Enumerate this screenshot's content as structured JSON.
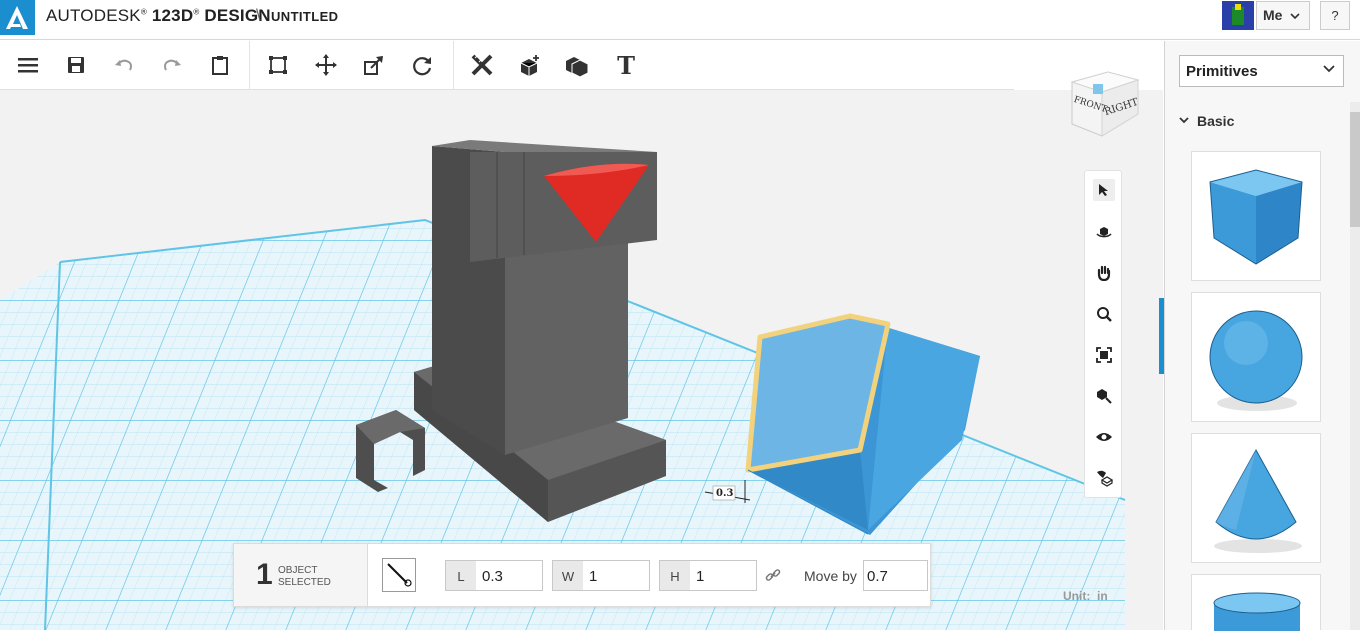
{
  "header": {
    "brand": "AUTODESK",
    "product": "123D",
    "product_suffix": "DESIGN",
    "separator": "\\",
    "document_title": "UNTITLED",
    "user_label": "Me",
    "help_label": "?"
  },
  "toolbar": {
    "text_tool_label": "T",
    "icons": [
      "menu-icon",
      "save-icon",
      "undo-icon",
      "redo-icon",
      "clipboard-icon",
      "smart-scale-icon",
      "move-icon",
      "scale-icon",
      "rotate-icon",
      "measure-icon",
      "primitives-icon",
      "combine-icon",
      "text-icon"
    ]
  },
  "viewcube": {
    "front": "FRONT",
    "right": "RIGHT"
  },
  "selection": {
    "count": "1",
    "label_line1": "OBJECT",
    "label_line2": "SELECTED",
    "dimension_tag": "0.3",
    "fields": [
      {
        "label": "L",
        "value": "0.3"
      },
      {
        "label": "W",
        "value": "1"
      },
      {
        "label": "H",
        "value": "1"
      }
    ],
    "move_by_label": "Move by",
    "move_by_value": "0.7"
  },
  "unit": {
    "label": "Unit:",
    "value": "in"
  },
  "panel": {
    "dropdown_value": "Primitives",
    "section_title": "Basic",
    "items": [
      "box-primitive",
      "sphere-primitive",
      "cone-primitive",
      "cylinder-primitive"
    ]
  },
  "colors": {
    "accent": "#1a8ecf",
    "selection_outline": "#f2d27c",
    "object_gray": "#5c5c5c",
    "cone_red": "#e02a24",
    "box_blue": "#4aa6e0",
    "grid_blue": "#5fc4e6"
  }
}
